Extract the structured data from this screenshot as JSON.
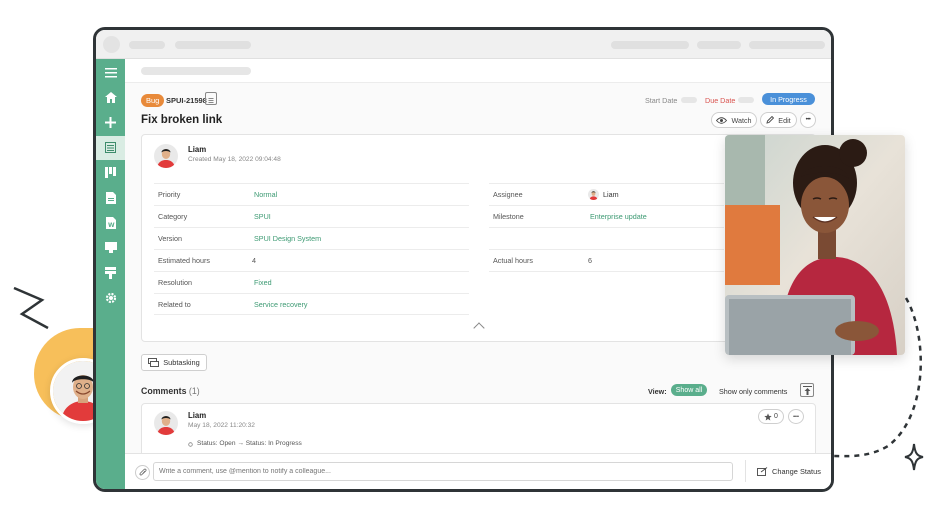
{
  "issue": {
    "type_tag": "Bug",
    "key": "SPUI-21598",
    "title": "Fix broken link",
    "start_date_label": "Start Date",
    "due_date_label": "Due Date",
    "status": "In Progress",
    "watch_label": "Watch",
    "edit_label": "Edit",
    "more_label": "•••"
  },
  "creator": {
    "name": "Liam",
    "created": "Created May 18, 2022 09:04:48"
  },
  "fields_left": [
    {
      "label": "Priority",
      "value": "Normal",
      "linked": true
    },
    {
      "label": "Category",
      "value": "SPUI",
      "linked": true
    },
    {
      "label": "Version",
      "value": "SPUI Design System",
      "linked": true
    },
    {
      "label": "Estimated hours",
      "value": "4",
      "linked": false
    },
    {
      "label": "Resolution",
      "value": "Fixed",
      "linked": true
    },
    {
      "label": "Related to",
      "value": "Service recovery",
      "linked": true
    }
  ],
  "fields_right": [
    {
      "label": "Assignee",
      "value": "Liam"
    },
    {
      "label": "Milestone",
      "value": "Enterprise update"
    },
    {
      "label": "",
      "value": ""
    },
    {
      "label": "Actual hours",
      "value": "6"
    }
  ],
  "subtasking_label": "Subtasking",
  "comments": {
    "heading": "Comments",
    "count": "(1)",
    "view_label": "View:",
    "show_all": "Show all",
    "show_only": "Show only comments",
    "items": [
      {
        "author": "Liam",
        "timestamp": "May 18, 2022 11:20:32",
        "change": "Status: Open → Status: In Progress",
        "stars": "0"
      }
    ]
  },
  "composer": {
    "placeholder": "Write a comment, use @mention to notify a colleague...",
    "change_status": "Change Status"
  },
  "colors": {
    "accent": "#5aae8c",
    "bug_tag": "#e88a3a",
    "status": "#4a90d9",
    "due": "#d9534f"
  }
}
